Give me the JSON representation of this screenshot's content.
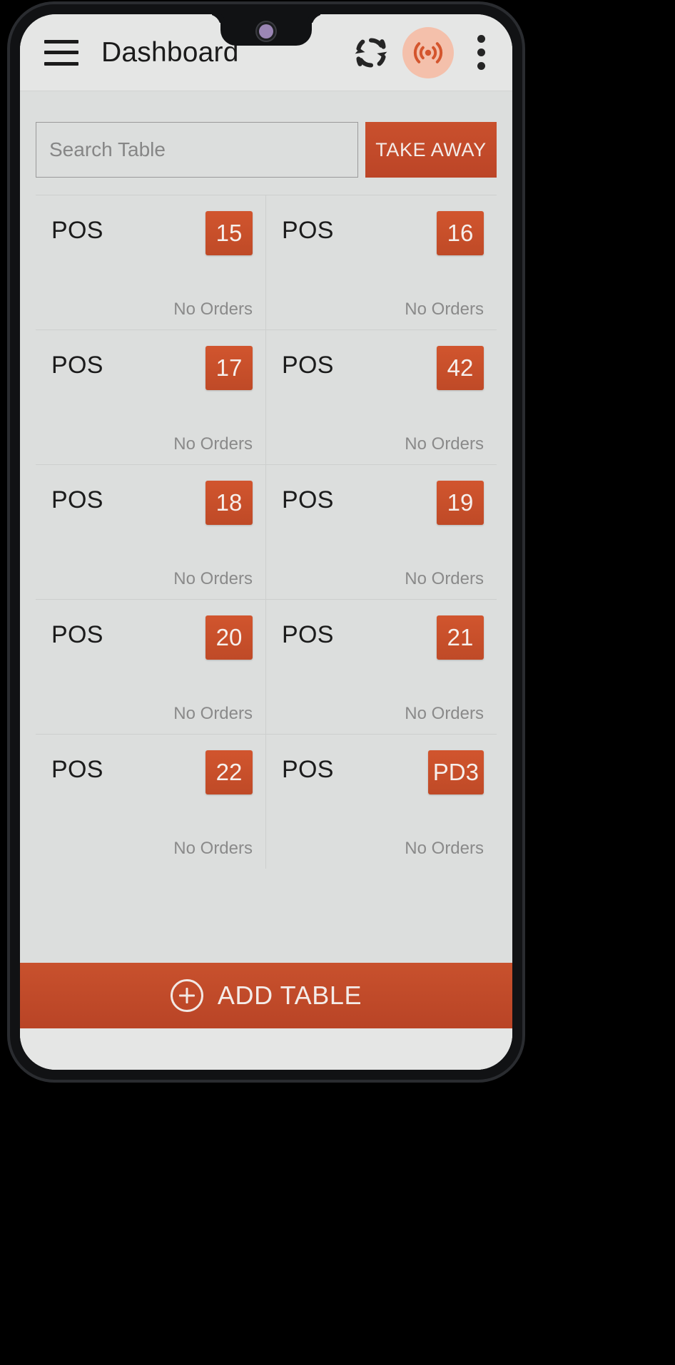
{
  "appbar": {
    "menu_icon": "hamburger-menu-icon",
    "title": "Dashboard",
    "sync_icon": "sync-refresh-icon",
    "broadcast_icon": "broadcast-signal-icon",
    "overflow_icon": "more-vertical-icon"
  },
  "search": {
    "placeholder": "Search Table",
    "value": "",
    "takeaway_label": "TAKE AWAY"
  },
  "tables": [
    {
      "label": "POS",
      "badge": "15",
      "status": "No Orders"
    },
    {
      "label": "POS",
      "badge": "16",
      "status": "No Orders"
    },
    {
      "label": "POS",
      "badge": "17",
      "status": "No Orders"
    },
    {
      "label": "POS",
      "badge": "42",
      "status": "No Orders"
    },
    {
      "label": "POS",
      "badge": "18",
      "status": "No Orders"
    },
    {
      "label": "POS",
      "badge": "19",
      "status": "No Orders"
    },
    {
      "label": "POS",
      "badge": "20",
      "status": "No Orders"
    },
    {
      "label": "POS",
      "badge": "21",
      "status": "No Orders"
    },
    {
      "label": "POS",
      "badge": "22",
      "status": "No Orders"
    },
    {
      "label": "POS",
      "badge": "PD3",
      "status": "No Orders"
    }
  ],
  "footer": {
    "add_table_label": "ADD TABLE",
    "add_icon": "plus-circle-icon"
  },
  "colors": {
    "accent": "#c4502c",
    "accent_light": "#f4c0ab",
    "surface": "#dcdedd",
    "appbar": "#e5e6e5",
    "text": "#1b1b1b",
    "muted": "#8a8a8a"
  }
}
